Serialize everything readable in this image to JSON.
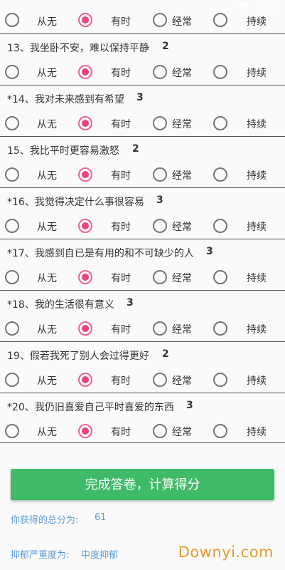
{
  "status_bar": {
    "time": "12:42"
  },
  "options": [
    "从无",
    "有时",
    "经常",
    "持续"
  ],
  "top_partial_row": {
    "selected": 1
  },
  "questions": [
    {
      "text": "13、我坐卧不安，难以保持平静",
      "score": "2",
      "selected": 1
    },
    {
      "text": "*14、我对未来感到有希望",
      "score": "3",
      "selected": 1
    },
    {
      "text": "15、我比平时更容易激怒",
      "score": "2",
      "selected": 1
    },
    {
      "text": "*16、我觉得决定什么事很容易",
      "score": "3",
      "selected": 1
    },
    {
      "text": "*17、我感到自已是有用的和不可缺少的人",
      "score": "3",
      "selected": 1
    },
    {
      "text": "*18、我的生活很有意义",
      "score": "3",
      "selected": 1
    },
    {
      "text": "19、假若我死了别人会过得更好",
      "score": "2",
      "selected": 1
    },
    {
      "text": "*20、我仍旧喜爱自己平时喜爱的东西",
      "score": "3",
      "selected": 1
    }
  ],
  "submit": {
    "label": "完成答卷，计算得分"
  },
  "result": {
    "total_label": "你获得的总分为:",
    "total_value": "61",
    "severity_label": "抑郁严重度为:",
    "severity_value": "中度抑郁"
  },
  "watermark": "Downyi.com",
  "colors": {
    "accent_green": "#3fba69",
    "radio_checked": "#e9447a",
    "result_text": "#5b9bd5",
    "watermark": "#e49a2d"
  }
}
